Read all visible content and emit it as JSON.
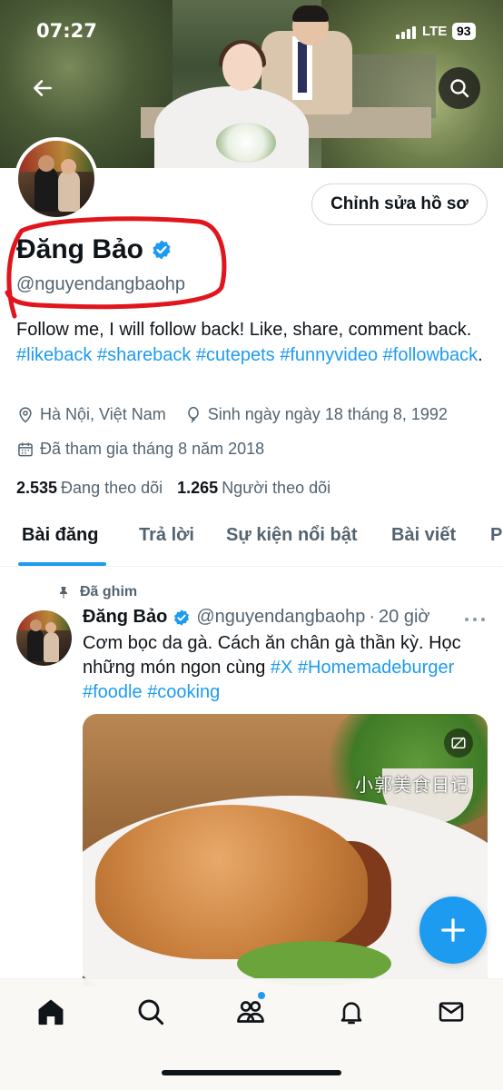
{
  "status_bar": {
    "time": "07:27",
    "network": "LTE",
    "battery": "93"
  },
  "profile": {
    "edit_button": "Chỉnh sửa hồ sơ",
    "name": "Đăng Bảo",
    "handle": "@nguyendangbaohp",
    "bio_text": "Follow me, I will follow back! Like, share, comment back.",
    "bio_hashtags": [
      "#likeback",
      "#shareback",
      "#cutepets",
      "#funnyvideo",
      "#followback"
    ],
    "bio_end": ".",
    "location": "Hà Nội, Việt Nam",
    "birthday": "Sinh ngày ngày 18 tháng 8, 1992",
    "joined": "Đã tham gia tháng 8 năm 2018",
    "following_count": "2.535",
    "following_label": "Đang theo dõi",
    "followers_count": "1.265",
    "followers_label": "Người theo dõi"
  },
  "tabs": [
    {
      "label": "Bài đăng",
      "active": true
    },
    {
      "label": "Trả lời",
      "active": false
    },
    {
      "label": "Sự kiện nổi bật",
      "active": false
    },
    {
      "label": "Bài viết",
      "active": false
    },
    {
      "label": "P",
      "active": false
    }
  ],
  "post": {
    "pinned_label": "Đã ghim",
    "author_name": "Đăng Bảo",
    "author_handle": "@nguyendangbaohp",
    "separator": "·",
    "time": "20 giờ",
    "text": "Cơm bọc da gà. Cách ăn chân gà thần kỳ. Học những món ngon cùng",
    "hashtags": [
      "#X",
      "#Homemadeburger",
      "#foodle",
      "#cooking"
    ],
    "media_watermark": "小郭美食日记"
  },
  "colors": {
    "accent": "#1d9bf0",
    "text_primary": "#0f1419",
    "text_secondary": "#536471",
    "annotation_red": "#e0161c"
  },
  "bottom_nav": {
    "items": [
      "home-icon",
      "search-icon",
      "communities-icon",
      "notifications-icon",
      "messages-icon"
    ]
  }
}
